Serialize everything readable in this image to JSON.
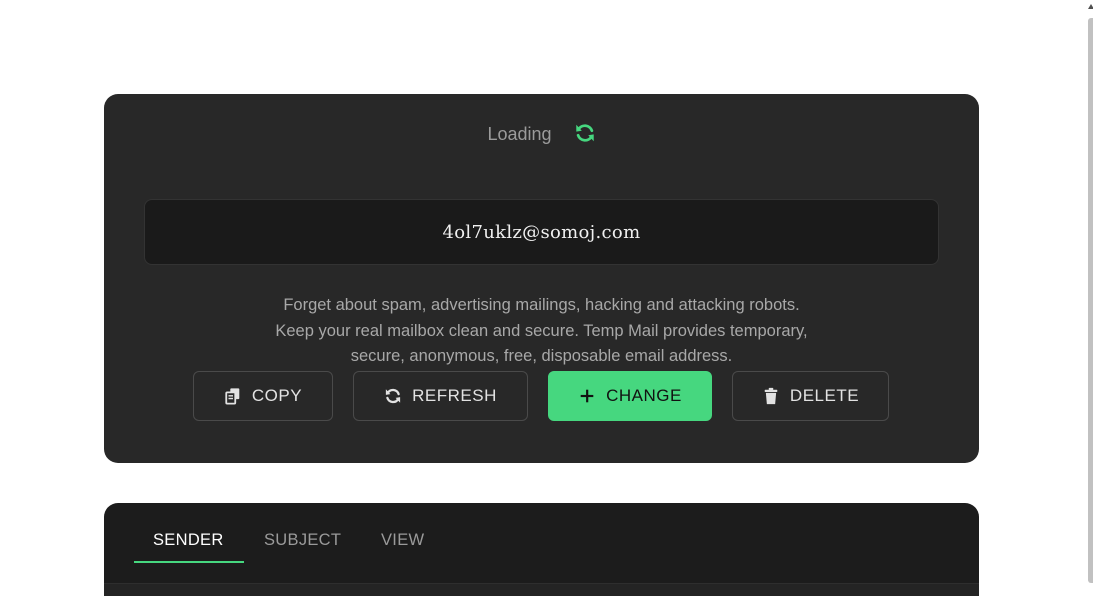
{
  "status": {
    "text": "Loading",
    "icon": "refresh-icon",
    "icon_color": "#46d77f"
  },
  "email": {
    "address": "4ol7uklz@somoj.com"
  },
  "description": {
    "line1": "Forget about spam, advertising mailings, hacking and attacking robots.",
    "line2": "Keep your real mailbox clean and secure. Temp Mail provides temporary,",
    "line3": "secure, anonymous, free, disposable email address."
  },
  "actions": {
    "copy": {
      "label": "COPY",
      "icon": "copy-icon"
    },
    "refresh": {
      "label": "REFRESH",
      "icon": "refresh-icon"
    },
    "change": {
      "label": "CHANGE",
      "icon": "plus-icon"
    },
    "delete": {
      "label": "DELETE",
      "icon": "trash-icon"
    }
  },
  "tabs": [
    {
      "label": "SENDER",
      "active": true
    },
    {
      "label": "SUBJECT",
      "active": false
    },
    {
      "label": "VIEW",
      "active": false
    }
  ],
  "colors": {
    "accent": "#46d77f",
    "card": "#282828",
    "email_box": "#1a1a1a"
  }
}
